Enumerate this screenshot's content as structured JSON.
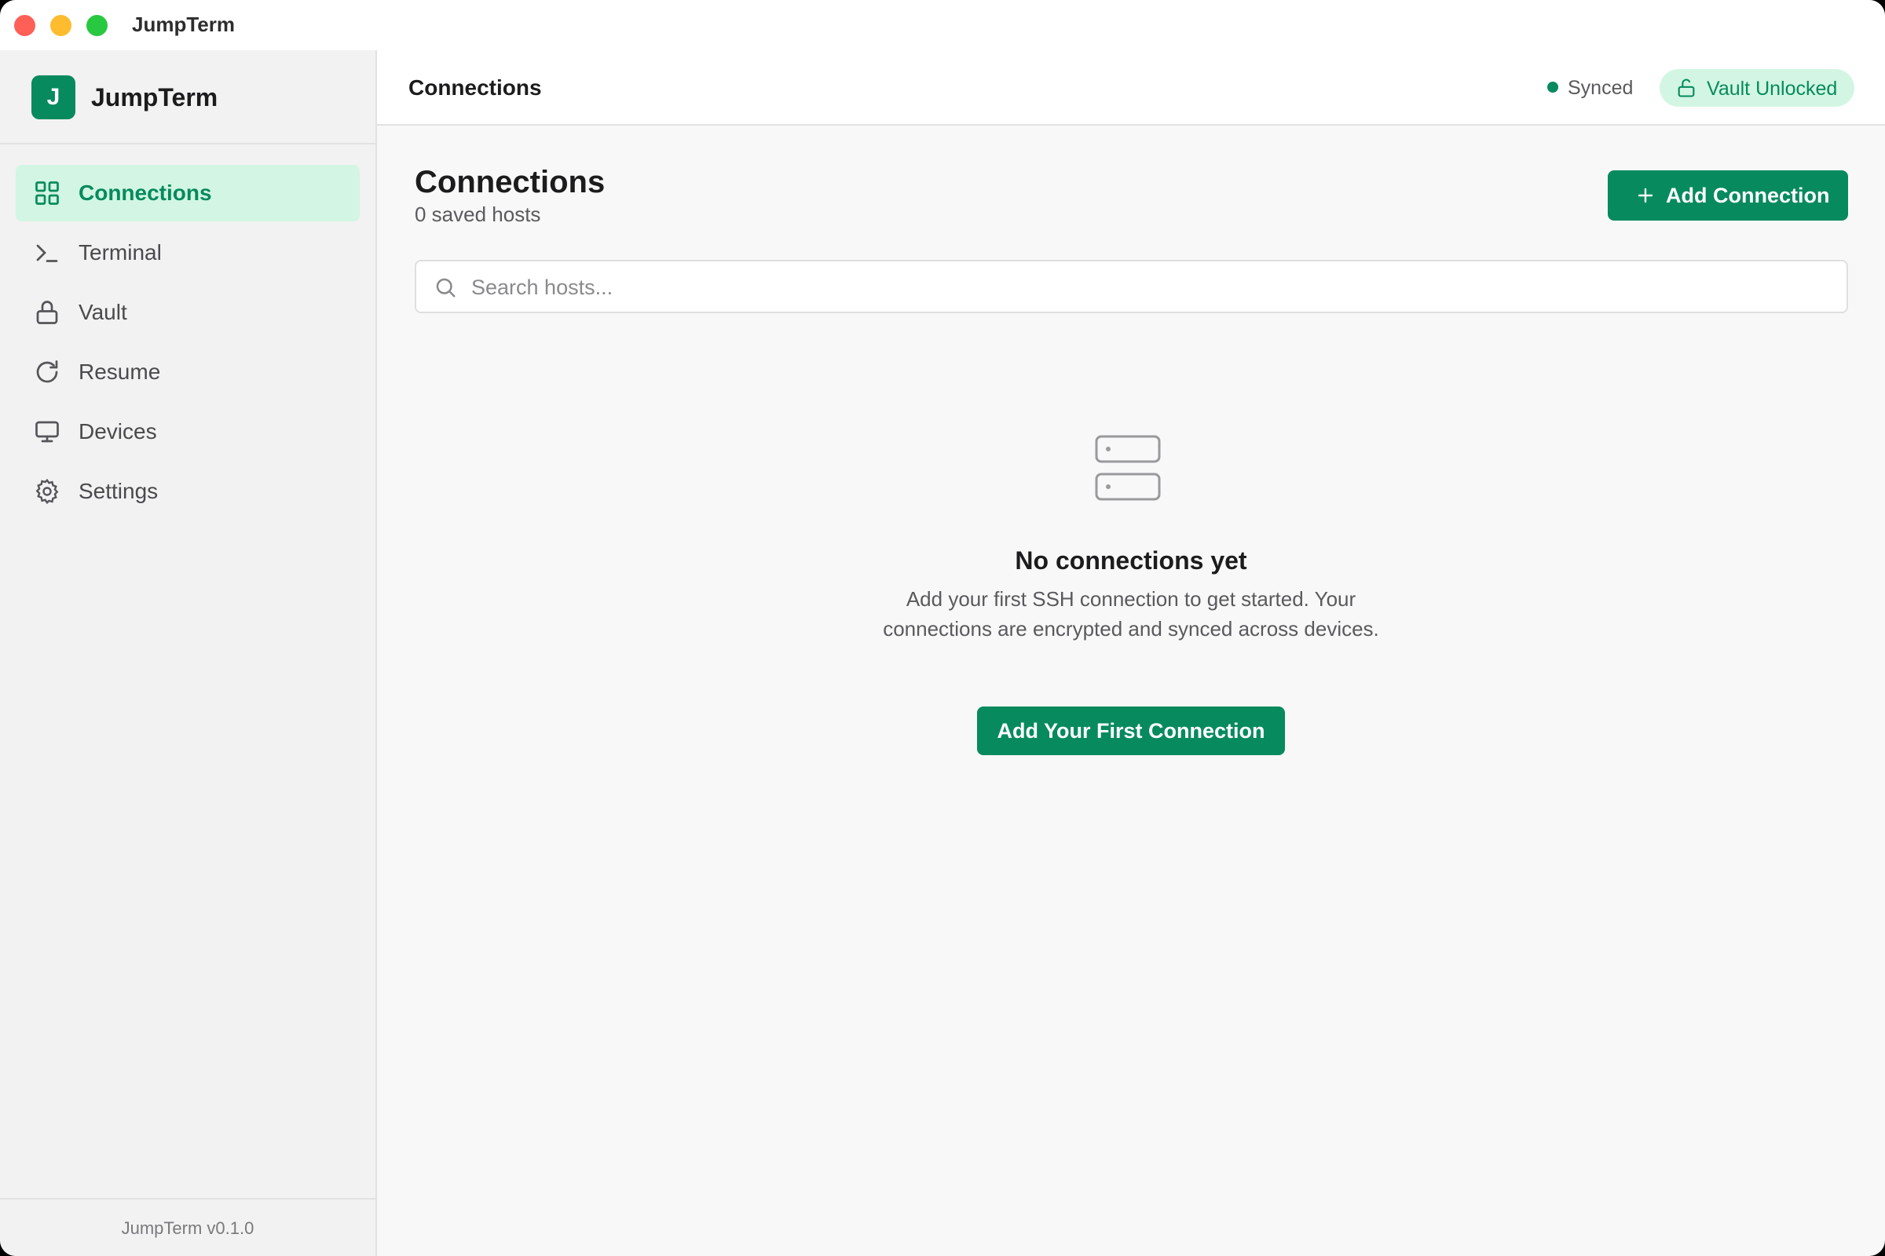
{
  "window": {
    "title": "JumpTerm"
  },
  "sidebar": {
    "brand": {
      "logo_letter": "J",
      "name": "JumpTerm"
    },
    "items": [
      {
        "label": "Connections",
        "icon": "grid-icon",
        "active": true
      },
      {
        "label": "Terminal",
        "icon": "terminal-icon",
        "active": false
      },
      {
        "label": "Vault",
        "icon": "lock-icon",
        "active": false
      },
      {
        "label": "Resume",
        "icon": "refresh-icon",
        "active": false
      },
      {
        "label": "Devices",
        "icon": "monitor-icon",
        "active": false
      },
      {
        "label": "Settings",
        "icon": "gear-icon",
        "active": false
      }
    ],
    "version": "JumpTerm v0.1.0"
  },
  "header": {
    "title": "Connections",
    "sync_status": "Synced",
    "vault_status": "Vault Unlocked"
  },
  "main": {
    "title": "Connections",
    "subtitle": "0 saved hosts",
    "add_button": "Add Connection",
    "search": {
      "placeholder": "Search hosts...",
      "value": ""
    },
    "empty": {
      "icon": "server-icon",
      "title": "No connections yet",
      "description": "Add your first SSH connection to get started. Your connections are encrypted and synced across devices.",
      "button": "Add Your First Connection"
    }
  },
  "colors": {
    "accent": "#078a5d",
    "accent_light": "#d2f6e3",
    "sidebar_bg": "#f2f2f2",
    "content_bg": "#f8f8f8"
  }
}
